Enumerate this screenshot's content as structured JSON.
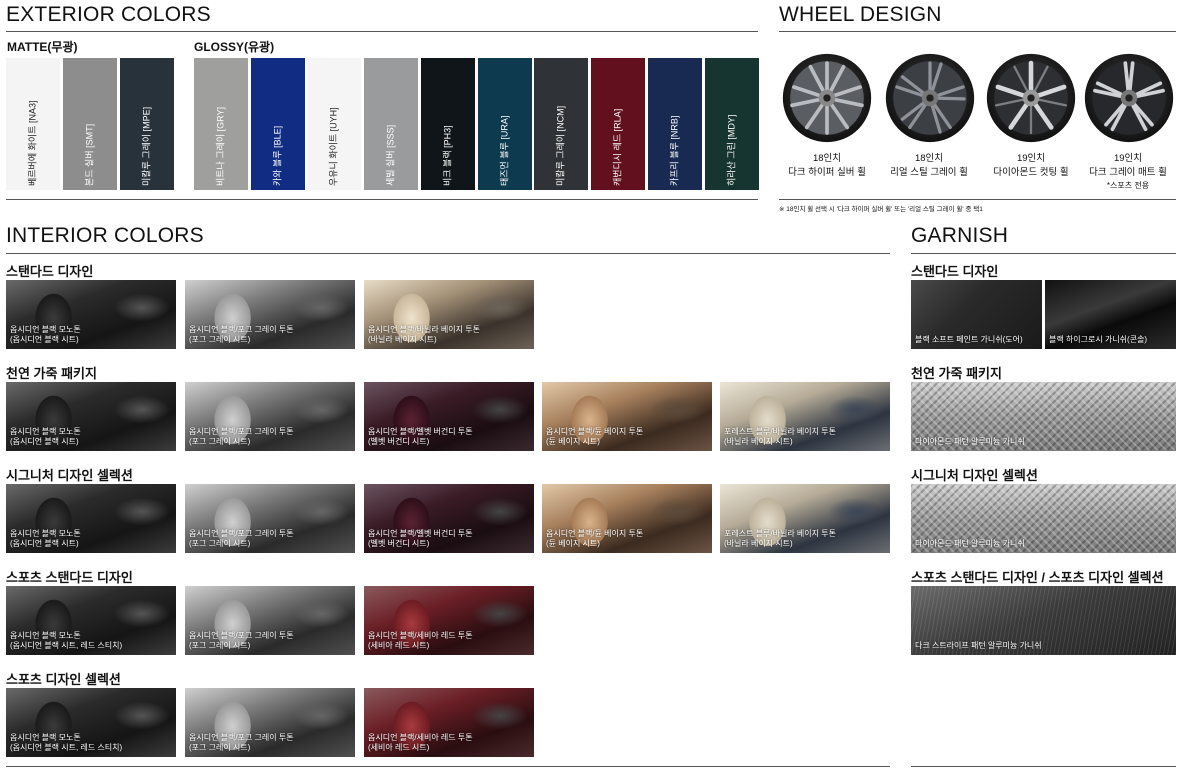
{
  "exterior": {
    "title": "EXTERIOR COLORS",
    "matte_label": "MATTE(무광)",
    "glossy_label": "GLOSSY(유광)",
    "matte": [
      {
        "name": "베르버에 화이트 [NA3]",
        "color": "#f4f4f4",
        "text": "#222"
      },
      {
        "name": "본드 실버 [SMT]",
        "color": "#8d8d8d",
        "text": "#fff"
      },
      {
        "name": "미칼루 그레이 [MPE]",
        "color": "#27323b",
        "text": "#fff"
      }
    ],
    "glossy": [
      {
        "name": "비트나 그레이 [GRY]",
        "color": "#9fa09e",
        "text": "#fff"
      },
      {
        "name": "카와 블루 [BLE]",
        "color": "#102c83",
        "text": "#fff"
      },
      {
        "name": "우유니 화이트 [UYH]",
        "color": "#f5f5f5",
        "text": "#222"
      },
      {
        "name": "세빌 실버 [SSS]",
        "color": "#9a9b9c",
        "text": "#fff"
      },
      {
        "name": "비크 블랙 [PH3]",
        "color": "#0f1518",
        "text": "#fff"
      },
      {
        "name": "태즈먼 블루 [URA]",
        "color": "#0e3a4f",
        "text": "#fff"
      },
      {
        "name": "미칼루 그레이 [NCM]",
        "color": "#2f3236",
        "text": "#fff"
      },
      {
        "name": "캐번디시 레드 [RLA]",
        "color": "#620f1e",
        "text": "#fff"
      },
      {
        "name": "카프리 블루 [NRB]",
        "color": "#182a52",
        "text": "#fff"
      },
      {
        "name": "히라산 그린 [MDY]",
        "color": "#173530",
        "text": "#fff"
      }
    ]
  },
  "wheels": {
    "title": "WHEEL DESIGN",
    "items": [
      {
        "size": "18인치",
        "name": "다크 하이퍼 실버 휠",
        "note": ""
      },
      {
        "size": "18인치",
        "name": "리얼 스틸 그레이 휠",
        "note": ""
      },
      {
        "size": "19인치",
        "name": "다이아몬드 컷팅 휠",
        "note": ""
      },
      {
        "size": "19인치",
        "name": "다크 그레이 매트 휠",
        "note": "*스포츠 전용"
      }
    ],
    "footnote": "※ 18인치 휠 선택 시 '다크 하이퍼 실버 휠' 또는 '리얼 스틸 그레이 휠' 중 택1"
  },
  "interior": {
    "title": "INTERIOR COLORS",
    "sections": [
      {
        "label": "스탠다드 디자인",
        "tiles": [
          {
            "l1": "옵시디언 블랙 모노톤",
            "l2": "(옵시디언 블랙 시트)"
          },
          {
            "l1": "옵시디언 블랙/포그 그레이 투톤",
            "l2": "(포그 그레이 시트)"
          },
          {
            "l1": "옵시디언 블랙/바닐라 베이지 투톤",
            "l2": "(바닐라 베이지 시트)"
          }
        ]
      },
      {
        "label": "천연 가죽 패키지",
        "tiles": [
          {
            "l1": "옵시디언 블랙 모노톤",
            "l2": "(옵시디언 블랙 시트)"
          },
          {
            "l1": "옵시디언 블랙/포그 그레이 투톤",
            "l2": "(포그 그레이 시트)"
          },
          {
            "l1": "옵시디언 블랙/벨벳 버건디 투톤",
            "l2": "(벨벳 버건디 시트)"
          },
          {
            "l1": "옵시디언 블랙/듄 베이지 투톤",
            "l2": "(듄 베이지 시트)"
          },
          {
            "l1": "포레스트 블루/바닐라 베이지 투톤",
            "l2": "(바닐라 베이지 시트)"
          }
        ]
      },
      {
        "label": "시그니처 디자인 셀렉션",
        "tiles": [
          {
            "l1": "옵시디언 블랙 모노톤",
            "l2": "(옵시디언 블랙 시트)"
          },
          {
            "l1": "옵시디언 블랙/포그 그레이 투톤",
            "l2": "(포그 그레이 시트)"
          },
          {
            "l1": "옵시디언 블랙/벨벳 버건디 투톤",
            "l2": "(벨벳 버건디 시트)"
          },
          {
            "l1": "옵시디언 블랙/듄 베이지 투톤",
            "l2": "(듄 베이지 시트)"
          },
          {
            "l1": "포레스트 블루/바닐라 베이지 투톤",
            "l2": "(바닐라 베이지 시트)"
          }
        ]
      },
      {
        "label": "스포츠 스탠다드 디자인",
        "tiles": [
          {
            "l1": "옵시디언 블랙 모노톤",
            "l2": "(옵시디언 블랙 시트, 레드 스티치)"
          },
          {
            "l1": "옵시디언 블랙/포그 그레이 투톤",
            "l2": "(포그 그레이 시트)"
          },
          {
            "l1": "옵시디언 블랙/세비아 레드 투톤",
            "l2": "(세비아 레드 시트)"
          }
        ]
      },
      {
        "label": "스포츠 디자인 셀렉션",
        "tiles": [
          {
            "l1": "옵시디언 블랙 모노톤",
            "l2": "(옵시디언 블랙 시트, 레드 스티치)"
          },
          {
            "l1": "옵시디언 블랙/포그 그레이 투톤",
            "l2": "(포그 그레이 시트)"
          },
          {
            "l1": "옵시디언 블랙/세비아 레드 투톤",
            "l2": "(세비아 레드 시트)"
          }
        ]
      }
    ]
  },
  "garnish": {
    "title": "GARNISH",
    "sections": [
      {
        "label": "스탠다드 디자인",
        "tiles": [
          {
            "caption": "블랙 소프트 페인트 가니쉬(도어)"
          },
          {
            "caption": "블랙 하이그로시 가니쉬(콘솔)"
          }
        ]
      },
      {
        "label": "천연 가죽 패키지",
        "tiles": [
          {
            "caption": "다이아몬드 패턴 알루미늄 가니쉬"
          }
        ]
      },
      {
        "label": "시그니처 디자인 셀렉션",
        "tiles": [
          {
            "caption": "다이아몬드 패턴 알루미늄 가니쉬"
          }
        ]
      },
      {
        "label": "스포츠 스탠다드 디자인 / 스포츠 디자인 셀렉션",
        "tiles": [
          {
            "caption": "다크 스트라이프 패턴 알루미늄 가니쉬"
          }
        ]
      }
    ]
  }
}
